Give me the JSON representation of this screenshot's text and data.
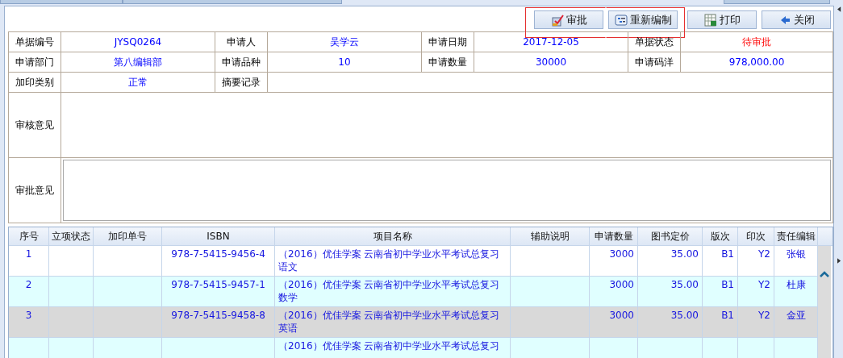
{
  "toolbar": {
    "buttons": [
      {
        "label": "审批",
        "highlighted": true
      },
      {
        "label": "重新编制",
        "highlighted": true
      },
      {
        "label": "打印",
        "highlighted": false
      },
      {
        "label": "关闭",
        "highlighted": false
      }
    ]
  },
  "form": {
    "rows": [
      [
        {
          "label": "单据编号",
          "value": "JYSQ0264",
          "kind": "text"
        },
        {
          "label": "申请人",
          "value": "吴学云",
          "kind": "text"
        },
        {
          "label": "申请日期",
          "value": "2017-12-05",
          "kind": "text"
        },
        {
          "label": "单据状态",
          "value": "待审批",
          "kind": "status"
        }
      ],
      [
        {
          "label": "申请部门",
          "value": "第八编辑部",
          "kind": "text"
        },
        {
          "label": "申请品种",
          "value": "10",
          "kind": "text"
        },
        {
          "label": "申请数量",
          "value": "30000",
          "kind": "text"
        },
        {
          "label": "申请码洋",
          "value": "978,000.00",
          "kind": "text"
        }
      ],
      [
        {
          "label": "加印类别",
          "value": "正常",
          "kind": "text"
        },
        {
          "label": "摘要记录"
        }
      ]
    ],
    "review": {
      "label": "审核意见"
    },
    "approval": {
      "label": "审批意见"
    }
  },
  "table": {
    "columns": [
      "序号",
      "立项状态",
      "加印单号",
      "ISBN",
      "项目名称",
      "辅助说明",
      "申请数量",
      "图书定价",
      "版次",
      "印次",
      "责任编辑"
    ],
    "rows": [
      {
        "selected": false,
        "cells": [
          "1",
          "",
          "",
          "978-7-5415-9456-4",
          "（2016）优佳学案 云南省初中学业水平考试总复习语文",
          "",
          "3000",
          "35.00",
          "B1",
          "Y2",
          "张银"
        ]
      },
      {
        "selected": false,
        "cells": [
          "2",
          "",
          "",
          "978-7-5415-9457-1",
          "（2016）优佳学案 云南省初中学业水平考试总复习数学",
          "",
          "3000",
          "35.00",
          "B1",
          "Y2",
          "杜康"
        ]
      },
      {
        "selected": true,
        "cells": [
          "3",
          "",
          "",
          "978-7-5415-9458-8",
          "（2016）优佳学案 云南省初中学业水平考试总复习英语",
          "",
          "3000",
          "35.00",
          "B1",
          "Y2",
          "金亚"
        ]
      },
      {
        "selected": false,
        "cells": [
          "",
          "",
          "",
          "",
          "（2016）优佳学案 云南省初中学业水平考试总复习",
          "",
          "",
          "",
          "",
          "",
          ""
        ]
      }
    ]
  }
}
